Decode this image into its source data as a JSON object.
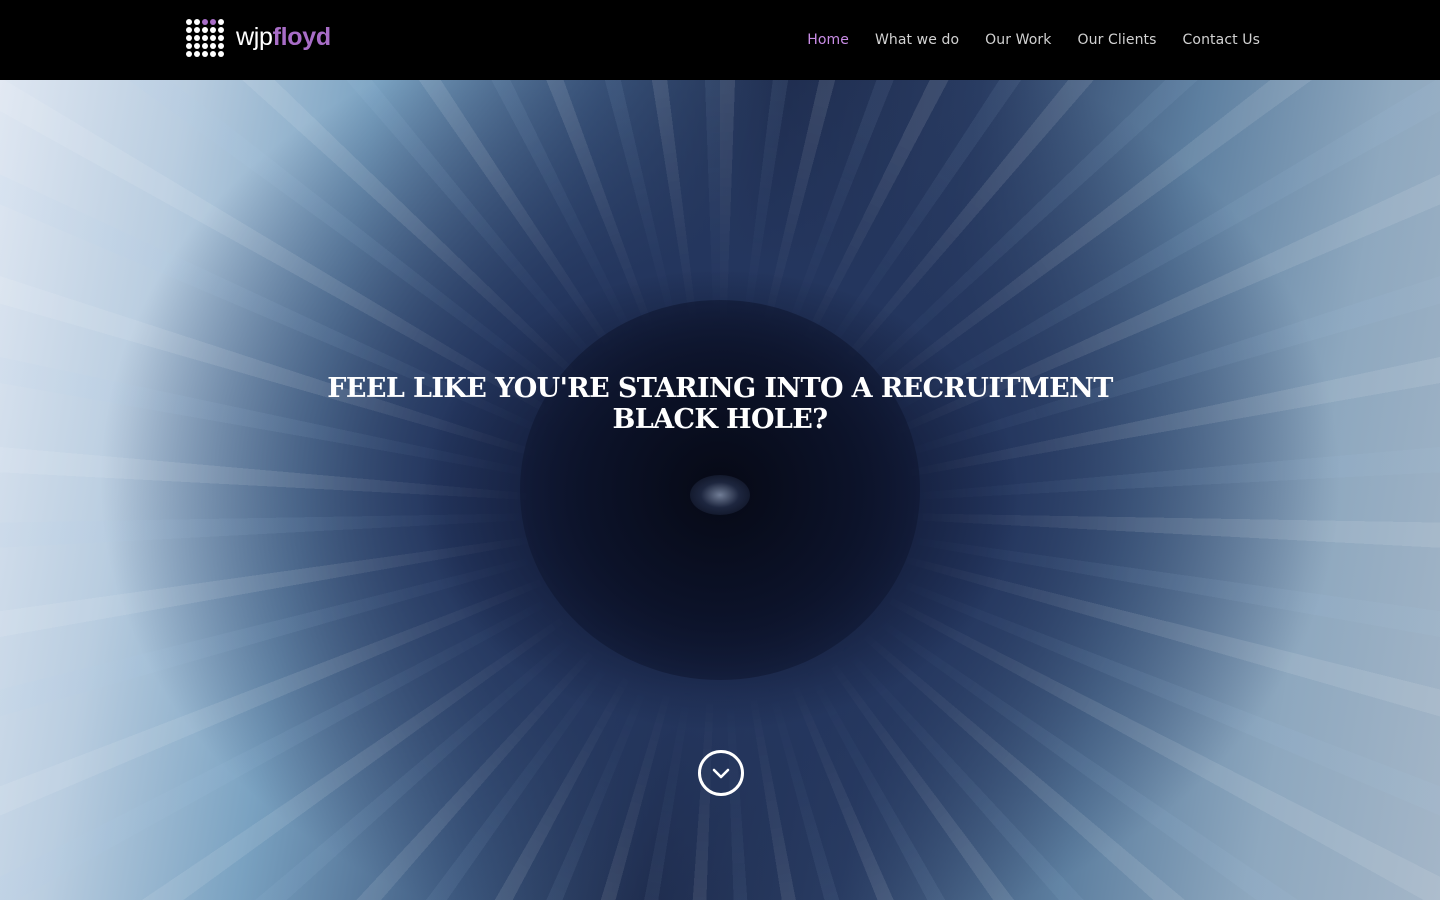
{
  "header": {
    "logo": {
      "text_part1": "wjp",
      "text_part2": "floyd",
      "accent_color": "#a86dc7"
    },
    "nav": [
      {
        "label": "Home",
        "active": true
      },
      {
        "label": "What we do",
        "active": false
      },
      {
        "label": "Our Work",
        "active": false
      },
      {
        "label": "Our Clients",
        "active": false
      },
      {
        "label": "Contact Us",
        "active": false
      }
    ],
    "active_color": "#c98de6"
  },
  "hero": {
    "headline_line1": "FEEL LIKE YOU'RE STARING INTO A RECRUITMENT",
    "headline_line2": "BLACK HOLE?",
    "scroll_icon": "chevron-down-circle-icon"
  }
}
